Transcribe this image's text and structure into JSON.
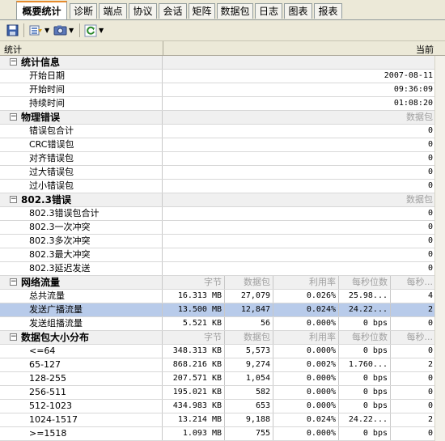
{
  "tabs": [
    "概要统计",
    "诊断",
    "端点",
    "协议",
    "会话",
    "矩阵",
    "数据包",
    "日志",
    "图表",
    "报表"
  ],
  "active_tab": 0,
  "toolbar": {
    "icons": [
      "save-icon",
      "column-select-icon",
      "snapshot-icon",
      "refresh-icon"
    ]
  },
  "header": {
    "col_name": "统计",
    "col_value": "当前"
  },
  "sections": {
    "stats_info": {
      "title": "统计信息",
      "rows": [
        {
          "label": "开始日期",
          "value": "2007-08-11"
        },
        {
          "label": "开始时间",
          "value": "09:36:09"
        },
        {
          "label": "持续时间",
          "value": "01:08:20"
        }
      ]
    },
    "phys_errors": {
      "title": "物理错误",
      "header": "数据包",
      "rows": [
        {
          "label": "错误包合计",
          "value": "0"
        },
        {
          "label": "CRC错误包",
          "value": "0"
        },
        {
          "label": "对齐错误包",
          "value": "0"
        },
        {
          "label": "过大错误包",
          "value": "0"
        },
        {
          "label": "过小错误包",
          "value": "0"
        }
      ]
    },
    "errors_8023": {
      "title": "802.3错误",
      "header": "数据包",
      "rows": [
        {
          "label": "802.3错误包合计",
          "value": "0"
        },
        {
          "label": "802.3一次冲突",
          "value": "0"
        },
        {
          "label": "802.3多次冲突",
          "value": "0"
        },
        {
          "label": "802.3最大冲突",
          "value": "0"
        },
        {
          "label": "802.3延迟发送",
          "value": "0"
        }
      ]
    },
    "traffic": {
      "title": "网络流量",
      "headers": [
        "字节",
        "数据包",
        "利用率",
        "每秒位数",
        "每秒..."
      ],
      "rows": [
        {
          "label": "总共流量",
          "bytes": "16.313 MB",
          "packets": "27,079",
          "util": "0.026%",
          "bps": "25.98...",
          "pps": "4"
        },
        {
          "label": "发送广播流量",
          "bytes": "13.500 MB",
          "packets": "12,847",
          "util": "0.024%",
          "bps": "24.22...",
          "pps": "2"
        },
        {
          "label": "发送组播流量",
          "bytes": "5.521 KB",
          "packets": "56",
          "util": "0.000%",
          "bps": "0 bps",
          "pps": "0"
        }
      ]
    },
    "size_dist": {
      "title": "数据包大小分布",
      "headers": [
        "字节",
        "数据包",
        "利用率",
        "每秒位数",
        "每秒..."
      ],
      "rows": [
        {
          "label": "<=64",
          "bytes": "348.313 KB",
          "packets": "5,573",
          "util": "0.000%",
          "bps": "0 bps",
          "pps": "0"
        },
        {
          "label": "65-127",
          "bytes": "868.216 KB",
          "packets": "9,274",
          "util": "0.002%",
          "bps": "1.760...",
          "pps": "2"
        },
        {
          "label": "128-255",
          "bytes": "207.571 KB",
          "packets": "1,054",
          "util": "0.000%",
          "bps": "0 bps",
          "pps": "0"
        },
        {
          "label": "256-511",
          "bytes": "195.021 KB",
          "packets": "582",
          "util": "0.000%",
          "bps": "0 bps",
          "pps": "0"
        },
        {
          "label": "512-1023",
          "bytes": "434.983 KB",
          "packets": "653",
          "util": "0.000%",
          "bps": "0 bps",
          "pps": "0"
        },
        {
          "label": "1024-1517",
          "bytes": "13.214 MB",
          "packets": "9,188",
          "util": "0.024%",
          "bps": "24.22...",
          "pps": "2"
        },
        {
          "label": ">=1518",
          "bytes": "1.093 MB",
          "packets": "755",
          "util": "0.000%",
          "bps": "0 bps",
          "pps": "0"
        }
      ]
    }
  }
}
